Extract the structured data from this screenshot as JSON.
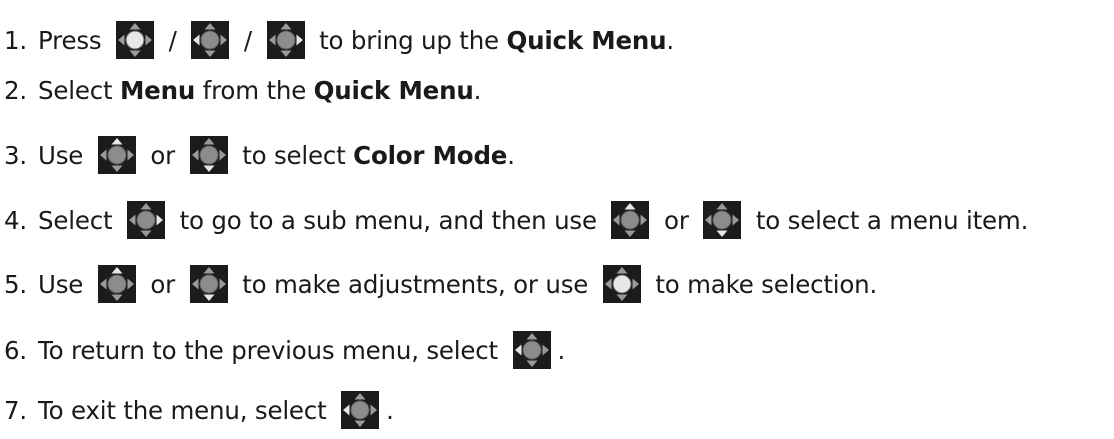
{
  "icons": {
    "background": "#1b1b1b",
    "joystick_body": "#8c8c8c",
    "arrow_dim": "#9a9a9a",
    "arrow_highlight": "#e6e6e6"
  },
  "steps": [
    {
      "number": "1.",
      "parts": [
        {
          "type": "text",
          "value": "Press "
        },
        {
          "type": "icon",
          "name": "joystick-center-icon",
          "highlight": [
            "center"
          ]
        },
        {
          "type": "text",
          "value": " / "
        },
        {
          "type": "icon",
          "name": "joystick-left-icon",
          "highlight": [
            "left"
          ]
        },
        {
          "type": "text",
          "value": " / "
        },
        {
          "type": "icon",
          "name": "joystick-right-icon",
          "highlight": [
            "right"
          ]
        },
        {
          "type": "text",
          "value": " to bring up the "
        },
        {
          "type": "bold",
          "value": "Quick Menu"
        },
        {
          "type": "text",
          "value": "."
        }
      ]
    },
    {
      "number": "2.",
      "parts": [
        {
          "type": "text",
          "value": "Select "
        },
        {
          "type": "bold",
          "value": "Menu"
        },
        {
          "type": "text",
          "value": " from the "
        },
        {
          "type": "bold",
          "value": "Quick Menu"
        },
        {
          "type": "text",
          "value": "."
        }
      ]
    },
    {
      "number": "3.",
      "parts": [
        {
          "type": "text",
          "value": "Use "
        },
        {
          "type": "icon",
          "name": "joystick-up-icon",
          "highlight": [
            "up"
          ]
        },
        {
          "type": "text",
          "value": " or "
        },
        {
          "type": "icon",
          "name": "joystick-down-icon",
          "highlight": [
            "down"
          ]
        },
        {
          "type": "text",
          "value": " to select "
        },
        {
          "type": "bold",
          "value": "Color Mode"
        },
        {
          "type": "text",
          "value": "."
        }
      ]
    },
    {
      "number": "4.",
      "parts": [
        {
          "type": "text",
          "value": "Select "
        },
        {
          "type": "icon",
          "name": "joystick-right-icon",
          "highlight": [
            "right"
          ]
        },
        {
          "type": "text",
          "value": " to go to a sub menu, and then use "
        },
        {
          "type": "icon",
          "name": "joystick-up-icon",
          "highlight": [
            "up"
          ]
        },
        {
          "type": "text",
          "value": " or "
        },
        {
          "type": "icon",
          "name": "joystick-down-icon",
          "highlight": [
            "down"
          ]
        },
        {
          "type": "text",
          "value": " to select a menu item."
        }
      ]
    },
    {
      "number": "5.",
      "parts": [
        {
          "type": "text",
          "value": "Use "
        },
        {
          "type": "icon",
          "name": "joystick-up-icon",
          "highlight": [
            "up"
          ]
        },
        {
          "type": "text",
          "value": " or "
        },
        {
          "type": "icon",
          "name": "joystick-down-icon",
          "highlight": [
            "down"
          ]
        },
        {
          "type": "text",
          "value": " to make adjustments, or use "
        },
        {
          "type": "icon",
          "name": "joystick-center-icon",
          "highlight": [
            "center"
          ]
        },
        {
          "type": "text",
          "value": " to make selection."
        }
      ]
    },
    {
      "number": "6.",
      "parts": [
        {
          "type": "text",
          "value": "To return to the previous menu, select "
        },
        {
          "type": "icon",
          "name": "joystick-left-icon",
          "highlight": [
            "left"
          ]
        },
        {
          "type": "text",
          "value": "."
        }
      ]
    },
    {
      "number": "7.",
      "parts": [
        {
          "type": "text",
          "value": "To exit the menu, select "
        },
        {
          "type": "icon",
          "name": "joystick-left-icon",
          "highlight": [
            "left"
          ]
        },
        {
          "type": "text",
          "value": "."
        }
      ]
    }
  ]
}
